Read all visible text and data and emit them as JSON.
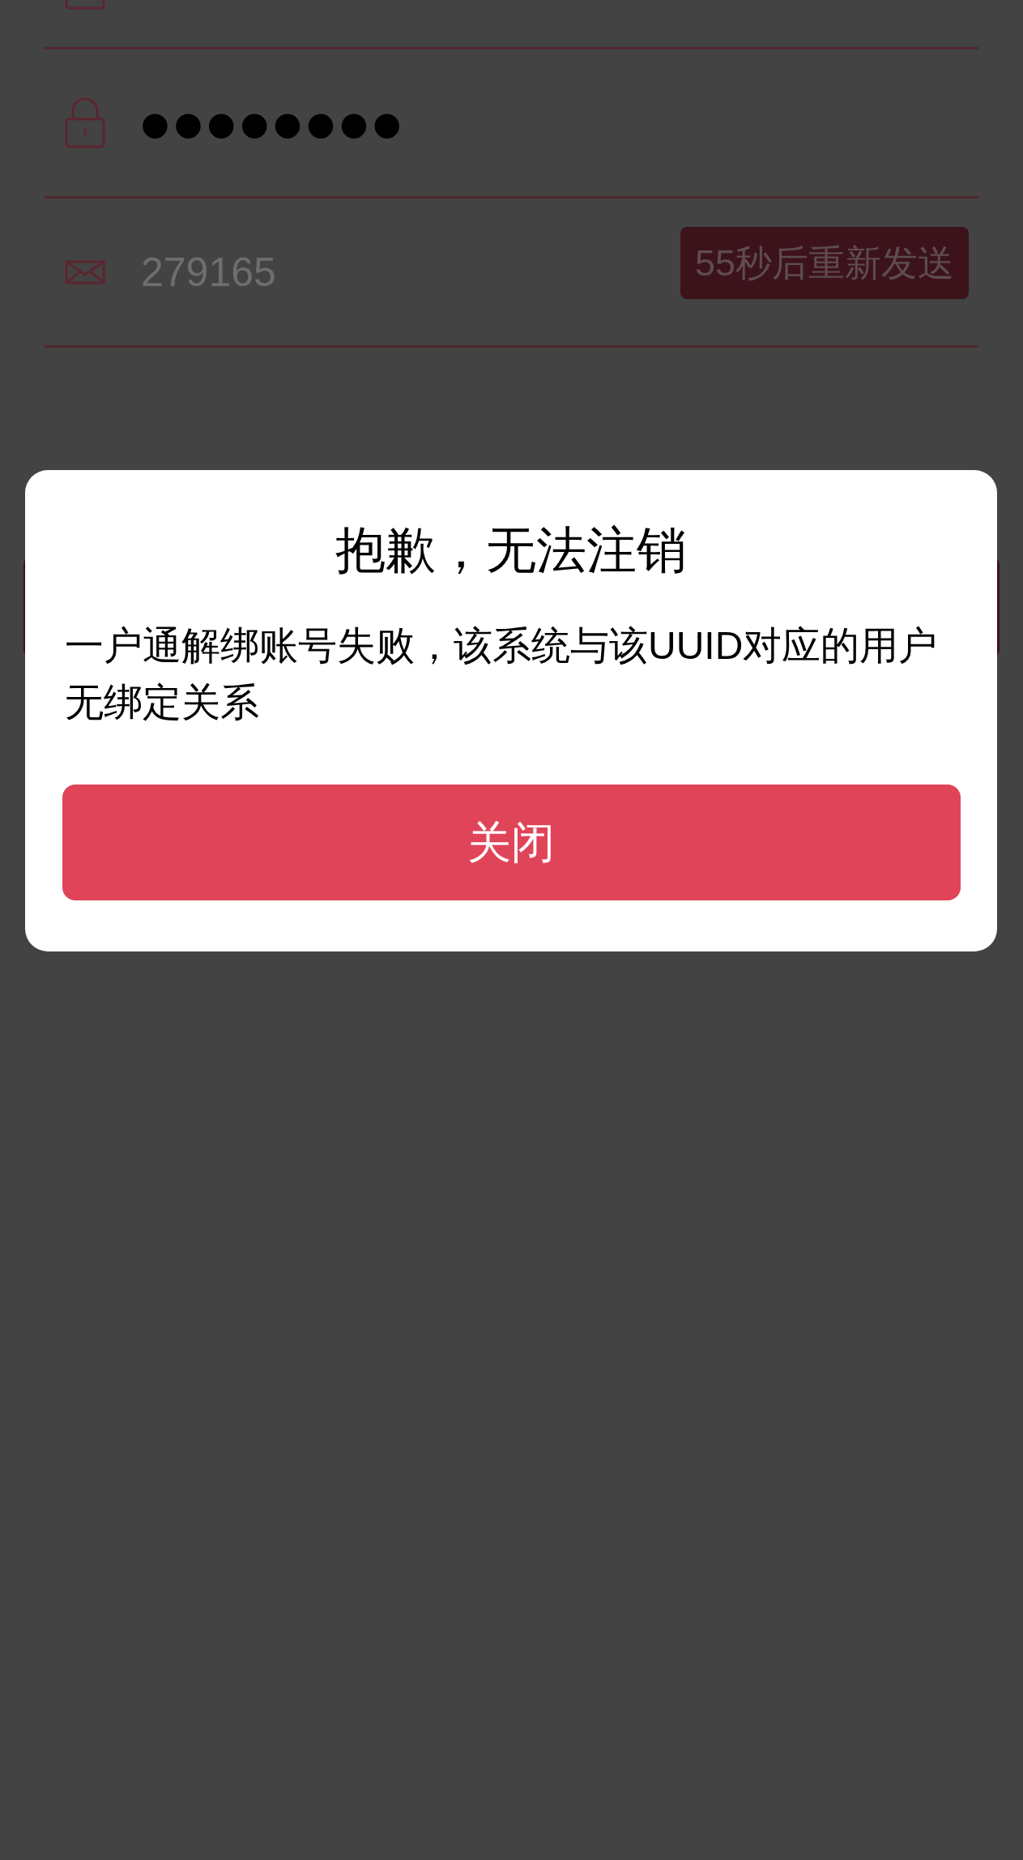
{
  "fields": [
    {
      "kind": "account"
    },
    {
      "kind": "password",
      "value": "●●●●●●●●"
    },
    {
      "kind": "code",
      "value": "279165",
      "button": "55秒后重新发送"
    }
  ],
  "dialog": {
    "title": "抱歉，无法注销",
    "message": "一户通解绑账号失败，该系统与该UUID对应的用户无绑定关系",
    "button": "关闭"
  }
}
